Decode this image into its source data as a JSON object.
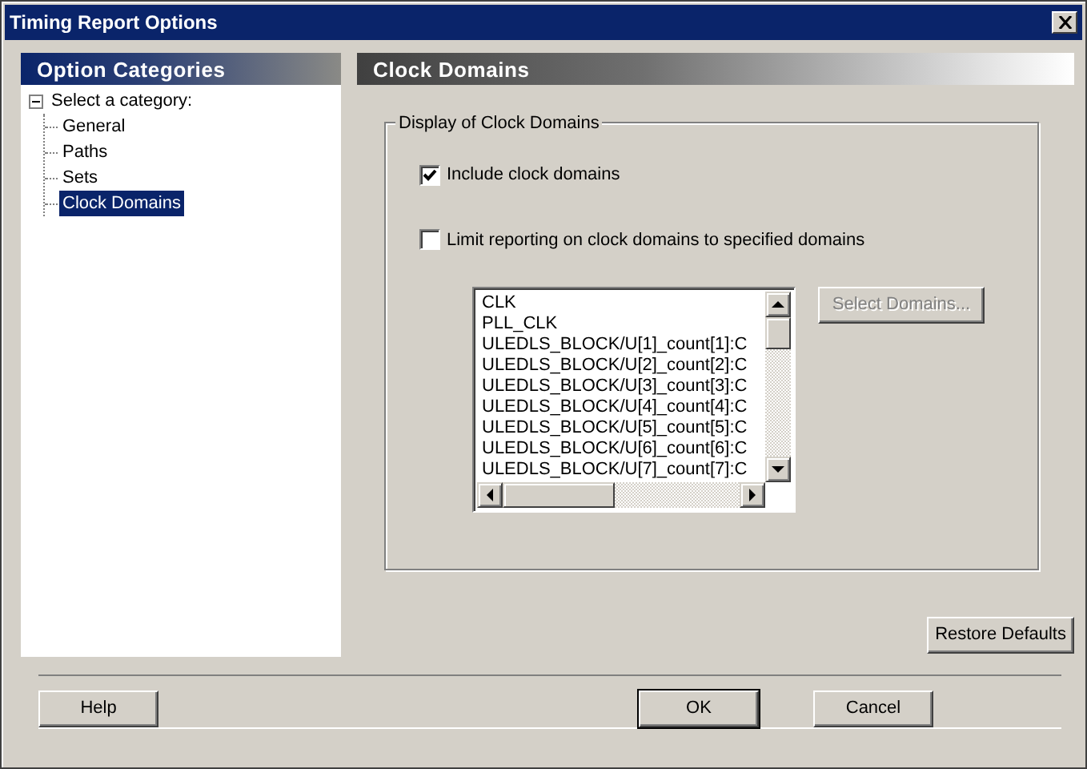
{
  "window": {
    "title": "Timing Report Options"
  },
  "sidebar": {
    "title": "Option Categories",
    "tree": {
      "label": "Select a category:",
      "expanded": true,
      "children": [
        {
          "label": "General",
          "selected": false
        },
        {
          "label": "Paths",
          "selected": false
        },
        {
          "label": "Sets",
          "selected": false
        },
        {
          "label": "Clock Domains",
          "selected": true
        }
      ]
    }
  },
  "panel": {
    "title": "Clock Domains",
    "group": {
      "title": "Display of Clock Domains",
      "options": [
        {
          "label": "Include clock domains",
          "checked": true
        },
        {
          "label": "Limit reporting on clock domains to specified domains",
          "checked": false
        }
      ],
      "domains_list": {
        "items": [
          "CLK",
          "PLL_CLK",
          "ULEDLS_BLOCK/U[1]_count[1]:C",
          "ULEDLS_BLOCK/U[2]_count[2]:C",
          "ULEDLS_BLOCK/U[3]_count[3]:C",
          "ULEDLS_BLOCK/U[4]_count[4]:C",
          "ULEDLS_BLOCK/U[5]_count[5]:C",
          "ULEDLS_BLOCK/U[6]_count[6]:C",
          "ULEDLS_BLOCK/U[7]_count[7]:C"
        ]
      },
      "select_button": {
        "label": "Select Domains...",
        "disabled": true
      }
    },
    "restore_button": {
      "label": "Restore Defaults"
    }
  },
  "buttons": [
    {
      "label": "Help",
      "default": false
    },
    {
      "label": "OK",
      "default": true
    },
    {
      "label": "Cancel",
      "default": false
    }
  ]
}
